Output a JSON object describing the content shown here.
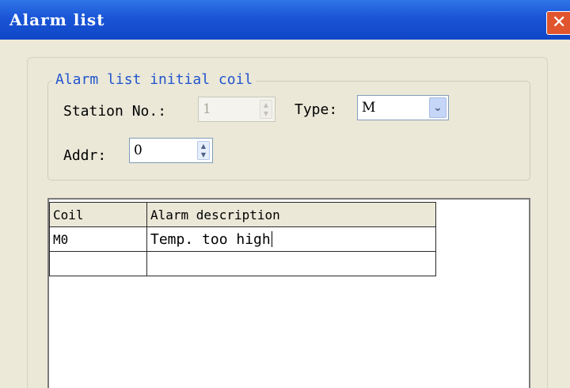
{
  "window": {
    "title": "Alarm list",
    "close_glyph": "✕"
  },
  "group": {
    "legend": "Alarm list initial coil",
    "station": {
      "label": "Station No.:",
      "value": "1",
      "enabled": false
    },
    "type": {
      "label": "Type:",
      "value": "M",
      "dropdown_glyph": "⌄"
    },
    "addr": {
      "label": "Addr:",
      "value": "0"
    }
  },
  "grid": {
    "columns": [
      "Coil",
      "Alarm description"
    ],
    "rows": [
      {
        "coil": "M0",
        "description": "Temp. too high",
        "editing": true
      },
      {
        "coil": "",
        "description": ""
      }
    ]
  },
  "icons": {
    "close": "close-icon",
    "spin_up": "spin-up-icon",
    "spin_down": "spin-down-icon",
    "dropdown": "chevron-down-icon"
  },
  "colors": {
    "titlebar": "#1a55d6",
    "close_button": "#e0552e",
    "group_legend": "#2255cc",
    "dialog_background": "#ece9d8"
  }
}
